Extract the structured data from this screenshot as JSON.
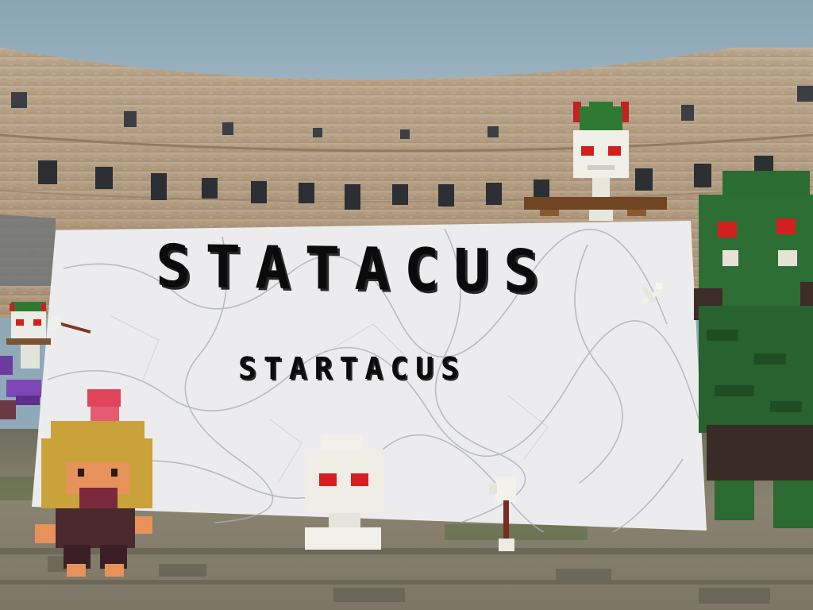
{
  "game": {
    "title": "STATACUS",
    "subtitle": "STARTACUS"
  },
  "colors": {
    "sky": "#8fa9b8",
    "colosseum_stone": "#b8a38a",
    "marble": "#e9e9eb",
    "title_text": "#0b0b0b",
    "skeleton_eyes": "#d41f1f",
    "ogre_green": "#2d6e34",
    "gladiator_helmet": "#c9a23a",
    "gladiator_plume": "#e0445c"
  },
  "characters": [
    "skeleton-general-icon",
    "green-ogre-icon",
    "gladiator-player-icon",
    "skeleton-skull-icon",
    "small-skeleton-icon",
    "purple-creature-icon"
  ],
  "items": [
    "arrow-icon",
    "flying-arrow-icon",
    "torch-arrow-icon"
  ]
}
